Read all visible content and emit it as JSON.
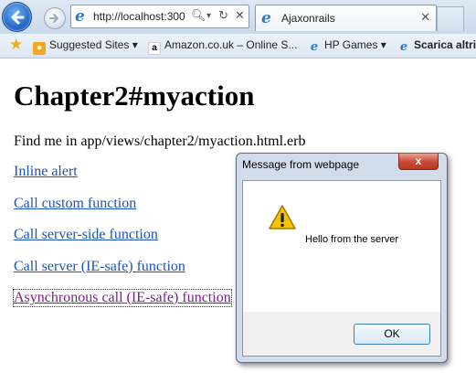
{
  "browser": {
    "address_url": "http://localhost:300",
    "tab_title": "Ajaxonrails",
    "favorites": [
      {
        "label": "Suggested Sites ▾"
      },
      {
        "label": "Amazon.co.uk – Online S..."
      },
      {
        "label": "HP Games ▾"
      },
      {
        "label": "Scarica altri"
      }
    ]
  },
  "page": {
    "title": "Chapter2#myaction",
    "note": "Find me in app/views/chapter2/myaction.html.erb",
    "links": [
      {
        "label": "Inline alert"
      },
      {
        "label": "Call custom function"
      },
      {
        "label": "Call server-side function"
      },
      {
        "label": "Call server (IE-safe) function"
      },
      {
        "label": "Asynchronous call (IE-safe) function"
      }
    ]
  },
  "dialog": {
    "title": "Message from webpage",
    "message": "Hello from the server",
    "ok_label": "OK",
    "close_label": "x"
  },
  "icons": {
    "back": "back-arrow-icon",
    "forward": "forward-arrow-icon",
    "warning": "warning-icon"
  },
  "colors": {
    "link": "#1a55b6",
    "visited_link": "#7b1f8a",
    "dialog_close": "#c74a35"
  }
}
